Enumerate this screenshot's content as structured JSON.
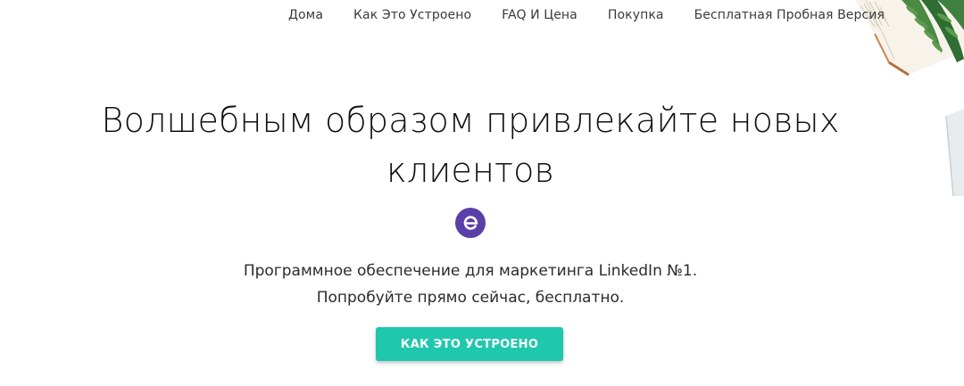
{
  "nav": {
    "items": [
      {
        "label": "Дома"
      },
      {
        "label": "Как Это Устроено"
      },
      {
        "label": "FAQ И Цена"
      },
      {
        "label": "Покупка"
      },
      {
        "label": "Бесплатная Пробная Версия"
      }
    ]
  },
  "hero": {
    "title_line1": "Волшебным образом привлекайте новых",
    "title_line2": "клиентов",
    "subtitle_line1": "Программное обеспечение для маркетинга LinkedIn №1.",
    "subtitle_line2": "Попробуйте прямо сейчас, бесплатно.",
    "cta_label": "КАК ЭТО УСТРОЕНО"
  },
  "colors": {
    "accent": "#1fc7ad",
    "logo": "#5b3fa8"
  }
}
